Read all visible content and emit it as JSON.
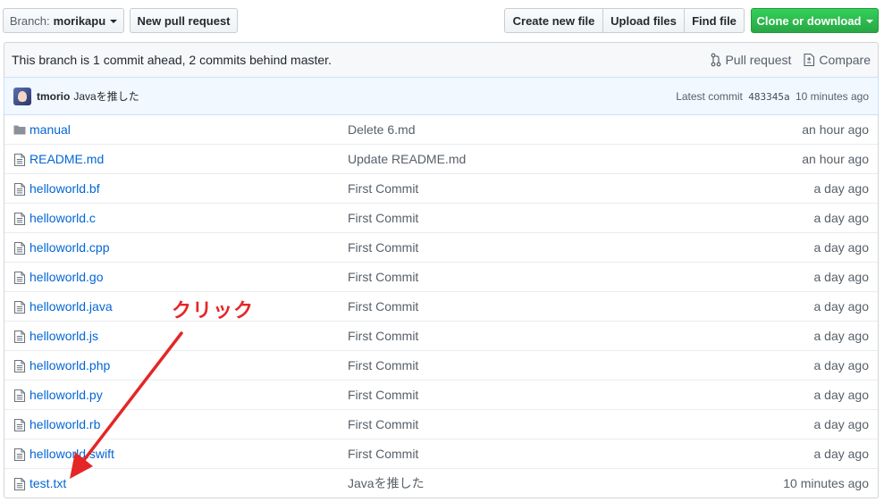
{
  "toolbar": {
    "branch_prefix": "Branch:",
    "branch_name": "morikapu",
    "new_pr": "New pull request",
    "create_file": "Create new file",
    "upload_files": "Upload files",
    "find_file": "Find file",
    "clone": "Clone or download"
  },
  "branch_info": {
    "message": "This branch is 1 commit ahead, 2 commits behind master.",
    "pull_request": "Pull request",
    "compare": "Compare"
  },
  "latest_commit": {
    "author": "tmorio",
    "message": "Javaを推した",
    "prefix": "Latest commit",
    "sha": "483345a",
    "age": "10 minutes ago"
  },
  "files": [
    {
      "name": "manual",
      "type": "folder-icon",
      "commit": "Delete 6.md",
      "age": "an hour ago"
    },
    {
      "name": "README.md",
      "type": "file-icon",
      "commit": "Update README.md",
      "age": "an hour ago"
    },
    {
      "name": "helloworld.bf",
      "type": "file-icon",
      "commit": "First Commit",
      "age": "a day ago"
    },
    {
      "name": "helloworld.c",
      "type": "file-icon",
      "commit": "First Commit",
      "age": "a day ago"
    },
    {
      "name": "helloworld.cpp",
      "type": "file-icon",
      "commit": "First Commit",
      "age": "a day ago"
    },
    {
      "name": "helloworld.go",
      "type": "file-icon",
      "commit": "First Commit",
      "age": "a day ago"
    },
    {
      "name": "helloworld.java",
      "type": "file-icon",
      "commit": "First Commit",
      "age": "a day ago"
    },
    {
      "name": "helloworld.js",
      "type": "file-icon",
      "commit": "First Commit",
      "age": "a day ago"
    },
    {
      "name": "helloworld.php",
      "type": "file-icon",
      "commit": "First Commit",
      "age": "a day ago"
    },
    {
      "name": "helloworld.py",
      "type": "file-icon",
      "commit": "First Commit",
      "age": "a day ago"
    },
    {
      "name": "helloworld.rb",
      "type": "file-icon",
      "commit": "First Commit",
      "age": "a day ago"
    },
    {
      "name": "helloworld.swift",
      "type": "file-icon",
      "commit": "First Commit",
      "age": "a day ago"
    },
    {
      "name": "test.txt",
      "type": "file-icon",
      "commit": "Javaを推した",
      "age": "10 minutes ago"
    }
  ],
  "annotation": {
    "text": "クリック",
    "color": "#e52626"
  },
  "colors": {
    "link": "#0366d6",
    "clone_button": "#28a745"
  }
}
